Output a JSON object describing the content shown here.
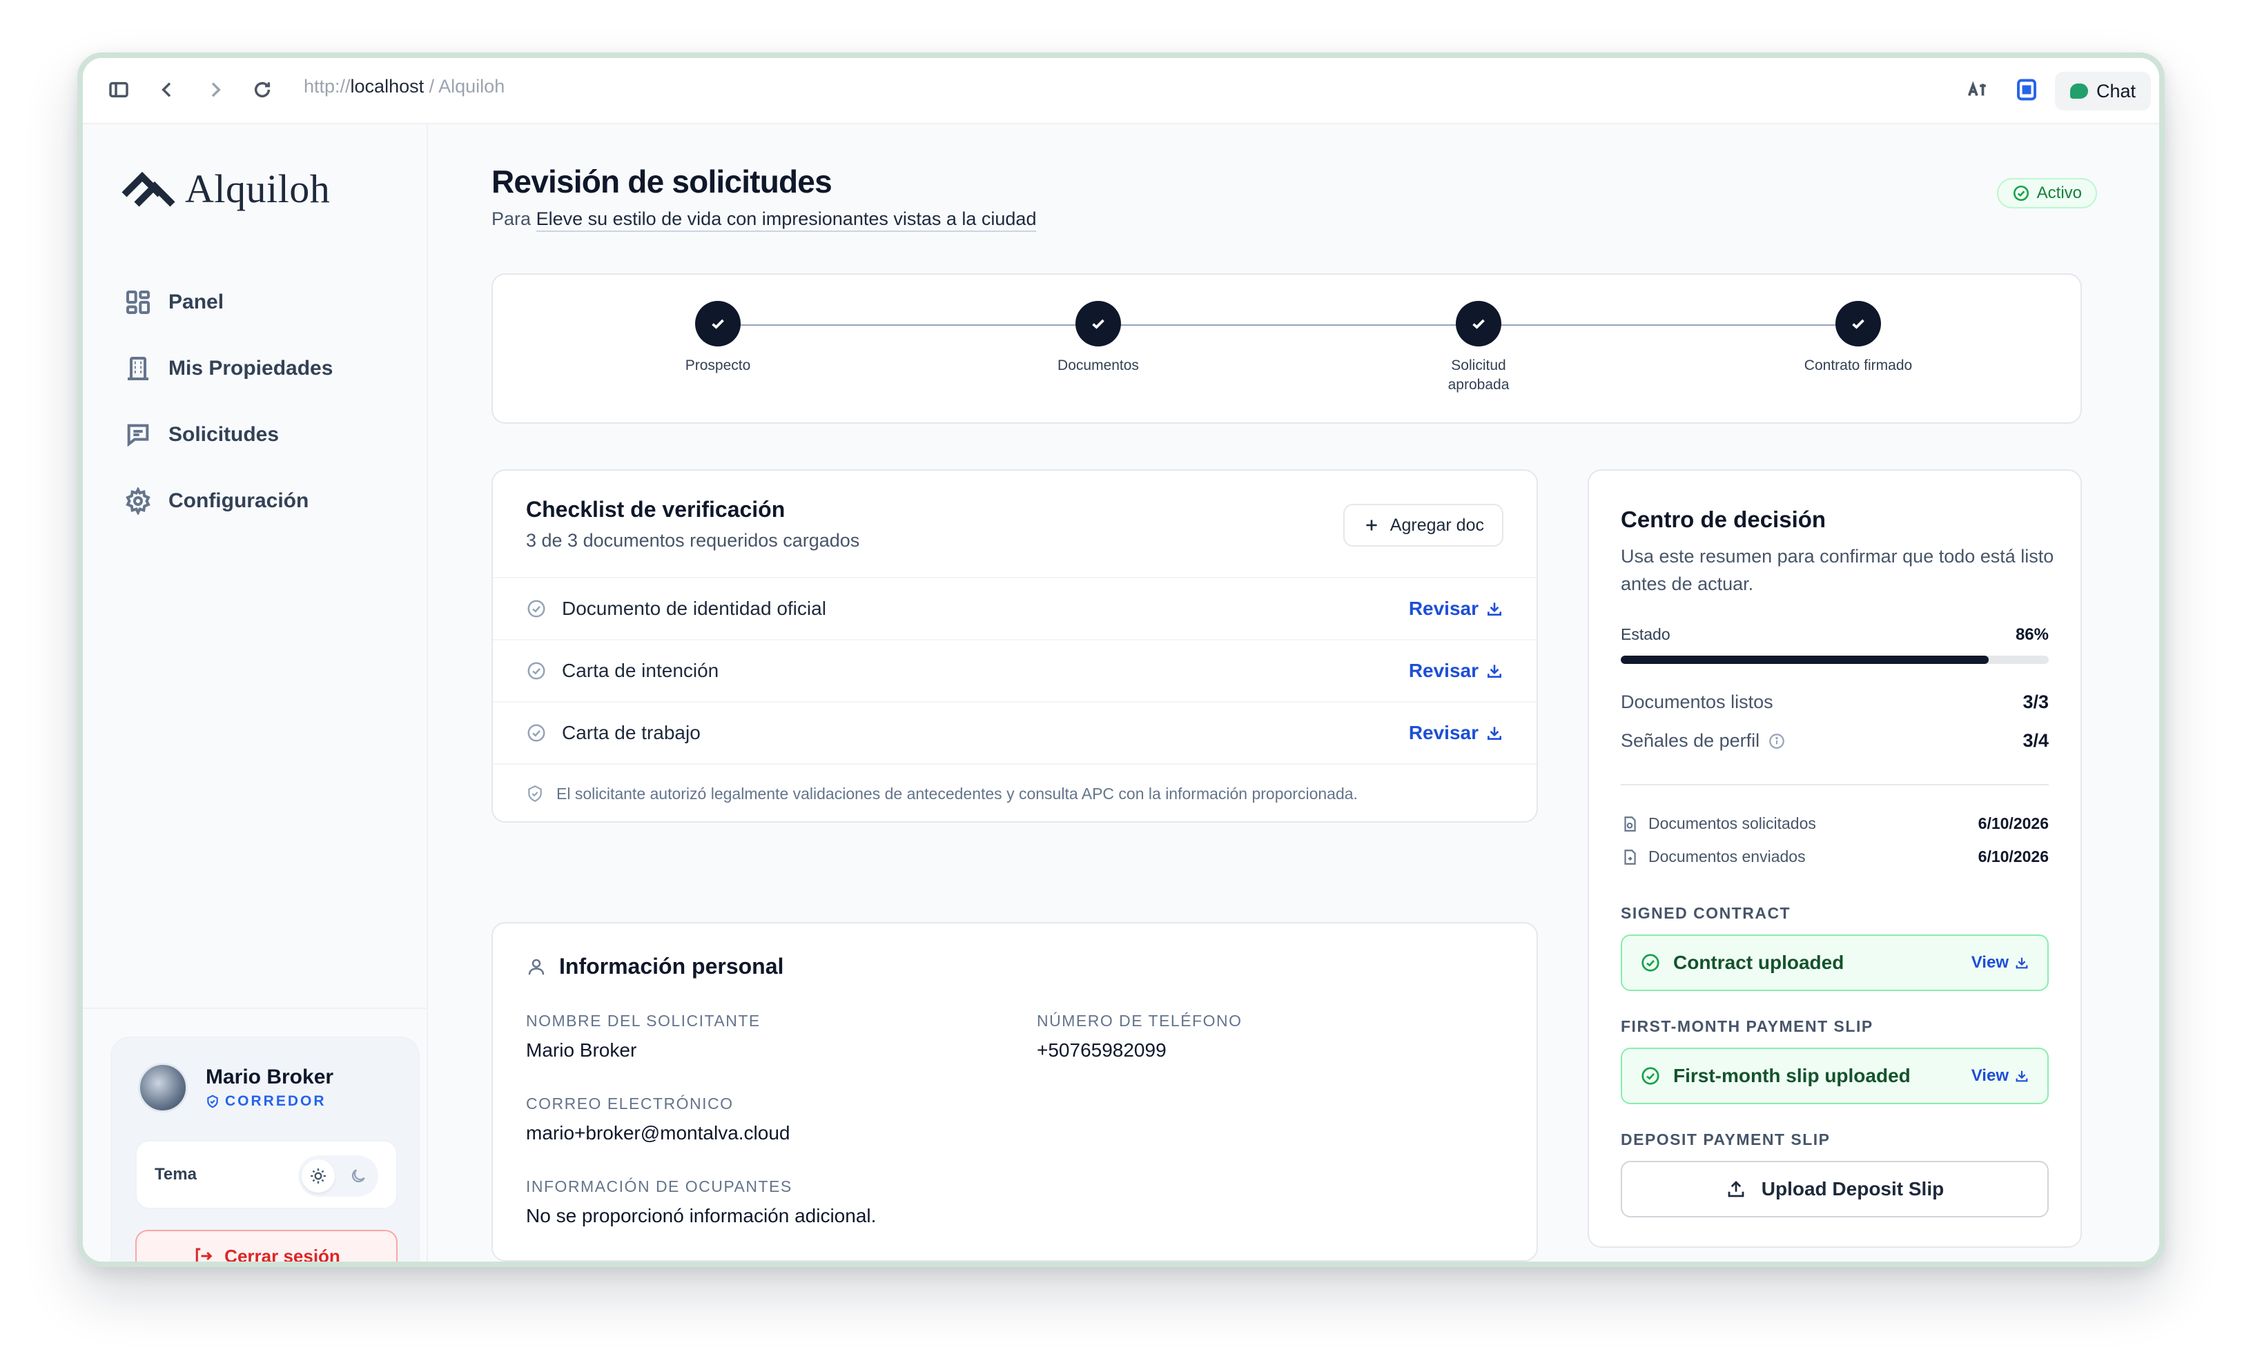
{
  "browser": {
    "url_scheme": "http://",
    "url_host": "localhost",
    "url_path": " / Alquiloh",
    "chat_label": "Chat"
  },
  "brand": {
    "name": "Alquiloh",
    "accent": "#1e293b"
  },
  "sidebar": {
    "items": [
      {
        "label": "Panel",
        "icon": "dashboard-icon"
      },
      {
        "label": "Mis Propiedades",
        "icon": "building-icon"
      },
      {
        "label": "Solicitudes",
        "icon": "message-icon"
      },
      {
        "label": "Configuración",
        "icon": "gear-icon"
      }
    ],
    "user": {
      "name": "Mario Broker",
      "role": "CORREDOR"
    },
    "theme_label": "Tema",
    "logout_label": "Cerrar sesión"
  },
  "page": {
    "title": "Revisión de solicitudes",
    "subtitle_prefix": "Para",
    "subtitle_link": "Eleve su estilo de vida con impresionantes vistas a la ciudad",
    "status": "Activo"
  },
  "stepper": {
    "steps": [
      {
        "label": "Prospecto",
        "done": true
      },
      {
        "label": "Documentos",
        "done": true
      },
      {
        "label": "Solicitud aprobada",
        "done": true
      },
      {
        "label": "Contrato firmado",
        "done": true
      }
    ]
  },
  "checklist": {
    "title": "Checklist de verificación",
    "subtitle": "3 de 3 documentos requeridos cargados",
    "add_button": "Agregar doc",
    "review_label": "Revisar",
    "items": [
      "Documento de identidad oficial",
      "Carta de intención",
      "Carta de trabajo"
    ],
    "note": "El solicitante autorizó legalmente validaciones de antecedentes y consulta APC con la información proporcionada."
  },
  "personal": {
    "title": "Información personal",
    "fields": {
      "name_label": "NOMBRE DEL SOLICITANTE",
      "name_value": "Mario Broker",
      "phone_label": "NÚMERO DE TELÉFONO",
      "phone_value": "+50765982099",
      "email_label": "CORREO ELECTRÓNICO",
      "email_value": "mario+broker@montalva.cloud",
      "occupants_label": "INFORMACIÓN DE OCUPANTES",
      "occupants_value": "No se proporcionó información adicional."
    }
  },
  "decision": {
    "title": "Centro de decisión",
    "description": "Usa este resumen para confirmar que todo está listo antes de actuar.",
    "progress_label": "Estado",
    "progress_value": "86%",
    "progress_fraction": 0.86,
    "stats": [
      {
        "label": "Documentos listos",
        "value": "3/3"
      },
      {
        "label": "Señales de perfil",
        "value": "3/4"
      }
    ],
    "dates": [
      {
        "label": "Documentos solicitados",
        "value": "6/10/2026"
      },
      {
        "label": "Documentos enviados",
        "value": "6/10/2026"
      }
    ],
    "signed_contract_label": "SIGNED CONTRACT",
    "signed_contract_status": "Contract uploaded",
    "first_month_label": "FIRST-MONTH PAYMENT SLIP",
    "first_month_status": "First-month slip uploaded",
    "view_label": "View",
    "deposit_label": "DEPOSIT PAYMENT SLIP",
    "deposit_button": "Upload Deposit Slip",
    "success_color": "#16a34a"
  }
}
